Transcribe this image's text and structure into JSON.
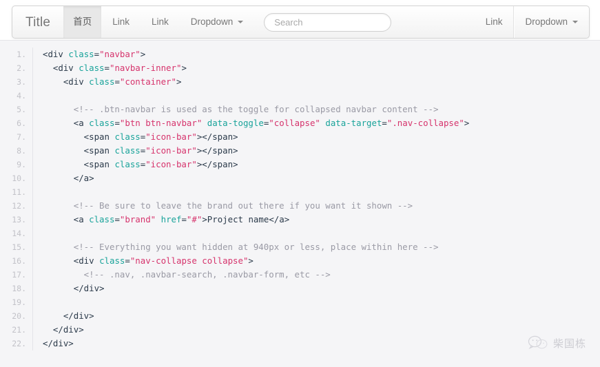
{
  "navbar": {
    "brand": "Title",
    "items": [
      {
        "label": "首页",
        "active": true,
        "caret": false,
        "divider": false
      },
      {
        "label": "Link",
        "active": false,
        "caret": false,
        "divider": false
      },
      {
        "label": "Link",
        "active": false,
        "caret": false,
        "divider": false
      },
      {
        "label": "Dropdown",
        "active": false,
        "caret": true,
        "divider": false
      }
    ],
    "search": {
      "value": "",
      "placeholder": "Search"
    },
    "right_items": [
      {
        "label": "Link",
        "active": false,
        "caret": false,
        "divider": false
      },
      {
        "label": "Dropdown",
        "active": false,
        "caret": true,
        "divider": true
      }
    ],
    "caret_icon": "chevron-down-icon",
    "search_icon": "search-input"
  },
  "code": {
    "language": "html",
    "line_numbers": [
      "1.",
      "2.",
      "3.",
      "4.",
      "5.",
      "6.",
      "7.",
      "8.",
      "9.",
      "10.",
      "11.",
      "12.",
      "13.",
      "14.",
      "15.",
      "16.",
      "17.",
      "18.",
      "19.",
      "20.",
      "21.",
      "22."
    ],
    "lines": [
      [
        {
          "t": "tag",
          "s": "<div "
        },
        {
          "t": "attr",
          "s": "class"
        },
        {
          "t": "eq",
          "s": "="
        },
        {
          "t": "str",
          "s": "\"navbar\""
        },
        {
          "t": "tag",
          "s": ">"
        }
      ],
      [
        {
          "t": "tag",
          "s": "  <div "
        },
        {
          "t": "attr",
          "s": "class"
        },
        {
          "t": "eq",
          "s": "="
        },
        {
          "t": "str",
          "s": "\"navbar-inner\""
        },
        {
          "t": "tag",
          "s": ">"
        }
      ],
      [
        {
          "t": "tag",
          "s": "    <div "
        },
        {
          "t": "attr",
          "s": "class"
        },
        {
          "t": "eq",
          "s": "="
        },
        {
          "t": "str",
          "s": "\"container\""
        },
        {
          "t": "tag",
          "s": ">"
        }
      ],
      [
        {
          "t": "txt",
          "s": ""
        }
      ],
      [
        {
          "t": "com",
          "s": "      <!-- .btn-navbar is used as the toggle for collapsed navbar content -->"
        }
      ],
      [
        {
          "t": "tag",
          "s": "      <a "
        },
        {
          "t": "attr",
          "s": "class"
        },
        {
          "t": "eq",
          "s": "="
        },
        {
          "t": "str",
          "s": "\"btn btn-navbar\""
        },
        {
          "t": "tag",
          "s": " "
        },
        {
          "t": "attr",
          "s": "data-toggle"
        },
        {
          "t": "eq",
          "s": "="
        },
        {
          "t": "str",
          "s": "\"collapse\""
        },
        {
          "t": "tag",
          "s": " "
        },
        {
          "t": "attr",
          "s": "data-target"
        },
        {
          "t": "eq",
          "s": "="
        },
        {
          "t": "str",
          "s": "\".nav-collapse\""
        },
        {
          "t": "tag",
          "s": ">"
        }
      ],
      [
        {
          "t": "tag",
          "s": "        <span "
        },
        {
          "t": "attr",
          "s": "class"
        },
        {
          "t": "eq",
          "s": "="
        },
        {
          "t": "str",
          "s": "\"icon-bar\""
        },
        {
          "t": "tag",
          "s": "></span>"
        }
      ],
      [
        {
          "t": "tag",
          "s": "        <span "
        },
        {
          "t": "attr",
          "s": "class"
        },
        {
          "t": "eq",
          "s": "="
        },
        {
          "t": "str",
          "s": "\"icon-bar\""
        },
        {
          "t": "tag",
          "s": "></span>"
        }
      ],
      [
        {
          "t": "tag",
          "s": "        <span "
        },
        {
          "t": "attr",
          "s": "class"
        },
        {
          "t": "eq",
          "s": "="
        },
        {
          "t": "str",
          "s": "\"icon-bar\""
        },
        {
          "t": "tag",
          "s": "></span>"
        }
      ],
      [
        {
          "t": "tag",
          "s": "      </a>"
        }
      ],
      [
        {
          "t": "txt",
          "s": ""
        }
      ],
      [
        {
          "t": "com",
          "s": "      <!-- Be sure to leave the brand out there if you want it shown -->"
        }
      ],
      [
        {
          "t": "tag",
          "s": "      <a "
        },
        {
          "t": "attr",
          "s": "class"
        },
        {
          "t": "eq",
          "s": "="
        },
        {
          "t": "str",
          "s": "\"brand\""
        },
        {
          "t": "tag",
          "s": " "
        },
        {
          "t": "attr",
          "s": "href"
        },
        {
          "t": "eq",
          "s": "="
        },
        {
          "t": "str",
          "s": "\"#\""
        },
        {
          "t": "tag",
          "s": ">"
        },
        {
          "t": "txt",
          "s": "Project name"
        },
        {
          "t": "tag",
          "s": "</a>"
        }
      ],
      [
        {
          "t": "txt",
          "s": ""
        }
      ],
      [
        {
          "t": "com",
          "s": "      <!-- Everything you want hidden at 940px or less, place within here -->"
        }
      ],
      [
        {
          "t": "tag",
          "s": "      <div "
        },
        {
          "t": "attr",
          "s": "class"
        },
        {
          "t": "eq",
          "s": "="
        },
        {
          "t": "str",
          "s": "\"nav-collapse collapse\""
        },
        {
          "t": "tag",
          "s": ">"
        }
      ],
      [
        {
          "t": "com",
          "s": "        <!-- .nav, .navbar-search, .navbar-form, etc -->"
        }
      ],
      [
        {
          "t": "tag",
          "s": "      </div>"
        }
      ],
      [
        {
          "t": "txt",
          "s": ""
        }
      ],
      [
        {
          "t": "tag",
          "s": "    </div>"
        }
      ],
      [
        {
          "t": "tag",
          "s": "  </div>"
        }
      ],
      [
        {
          "t": "tag",
          "s": "</div>"
        }
      ]
    ]
  },
  "watermark": {
    "logo": "wechat-icon",
    "text": "柴国栋"
  },
  "colors": {
    "tag": "#2b3a4a",
    "attribute": "#19a39a",
    "value": "#d6336c",
    "comment": "#9a9aa5",
    "code_background": "#f5f5f7",
    "line_number": "#c2c2c8",
    "navbar_active": "#e8e8e8"
  }
}
